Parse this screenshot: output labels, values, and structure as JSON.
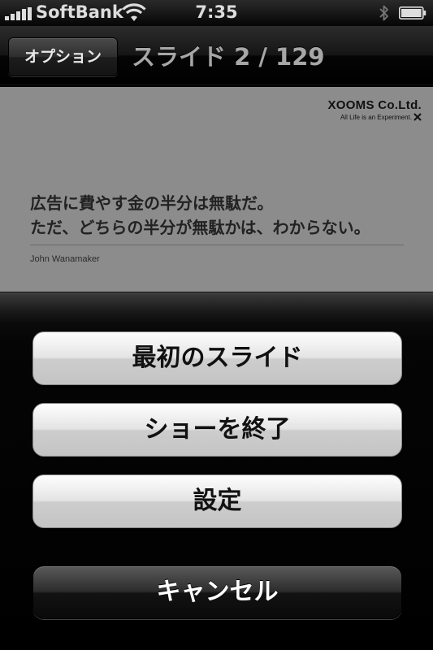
{
  "status_bar": {
    "carrier": "SoftBank",
    "time": "7:35",
    "icons": [
      "signal-bars-icon",
      "wifi-icon",
      "bluetooth-icon",
      "battery-icon"
    ]
  },
  "nav": {
    "options_label": "オプション",
    "title": "スライド 2 / 129"
  },
  "slide": {
    "logo_main": "XOOMS Co.Ltd.",
    "logo_sub": "All Life is an Experiment.",
    "quote_line1": "広告に費やす金の半分は無駄だ。",
    "quote_line2": "ただ、どちらの半分が無駄かは、わからない。",
    "author": "John Wanamaker",
    "background": "#8c8c8c"
  },
  "action_sheet": {
    "buttons": [
      {
        "label": "最初のスライド",
        "style": "light"
      },
      {
        "label": "ショーを終了",
        "style": "light"
      },
      {
        "label": "設定",
        "style": "light"
      }
    ],
    "cancel_label": "キャンセル"
  }
}
